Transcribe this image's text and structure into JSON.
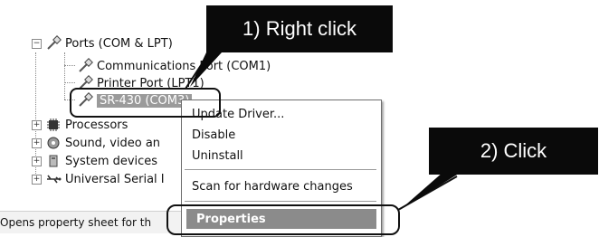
{
  "tree": {
    "ports_label": "Ports (COM & LPT)",
    "children": [
      {
        "label": "Communications Port (COM1)"
      },
      {
        "label": "Printer Port (LPT1)"
      },
      {
        "label": "SR-430 (COM3)"
      }
    ],
    "siblings": [
      {
        "label": "Processors"
      },
      {
        "label": "Sound, video an"
      },
      {
        "label": "System devices"
      },
      {
        "label": "Universal Serial I"
      }
    ],
    "expander_collapsed": "+",
    "expander_expanded": "−"
  },
  "context_menu": {
    "items": [
      "Update Driver...",
      "Disable",
      "Uninstall",
      "Scan for hardware changes",
      "Properties"
    ]
  },
  "status_bar": {
    "text": "Opens property sheet for th"
  },
  "callouts": {
    "step1": "1) Right click",
    "step2": "2) Click"
  },
  "icons": [
    "port-icon",
    "processor-icon",
    "sound-icon",
    "system-devices-icon",
    "usb-icon"
  ]
}
